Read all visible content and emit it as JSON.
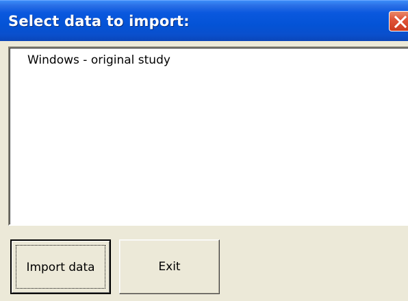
{
  "dialog": {
    "title": "Select data to import:",
    "close_icon": "close-icon"
  },
  "list": {
    "items": [
      {
        "label": "Windows - original study"
      }
    ]
  },
  "buttons": {
    "import_label": "Import data",
    "exit_label": "Exit"
  },
  "colors": {
    "titlebar": "#0453d6",
    "close_button": "#e0563a",
    "window_background": "#ece9d8"
  }
}
